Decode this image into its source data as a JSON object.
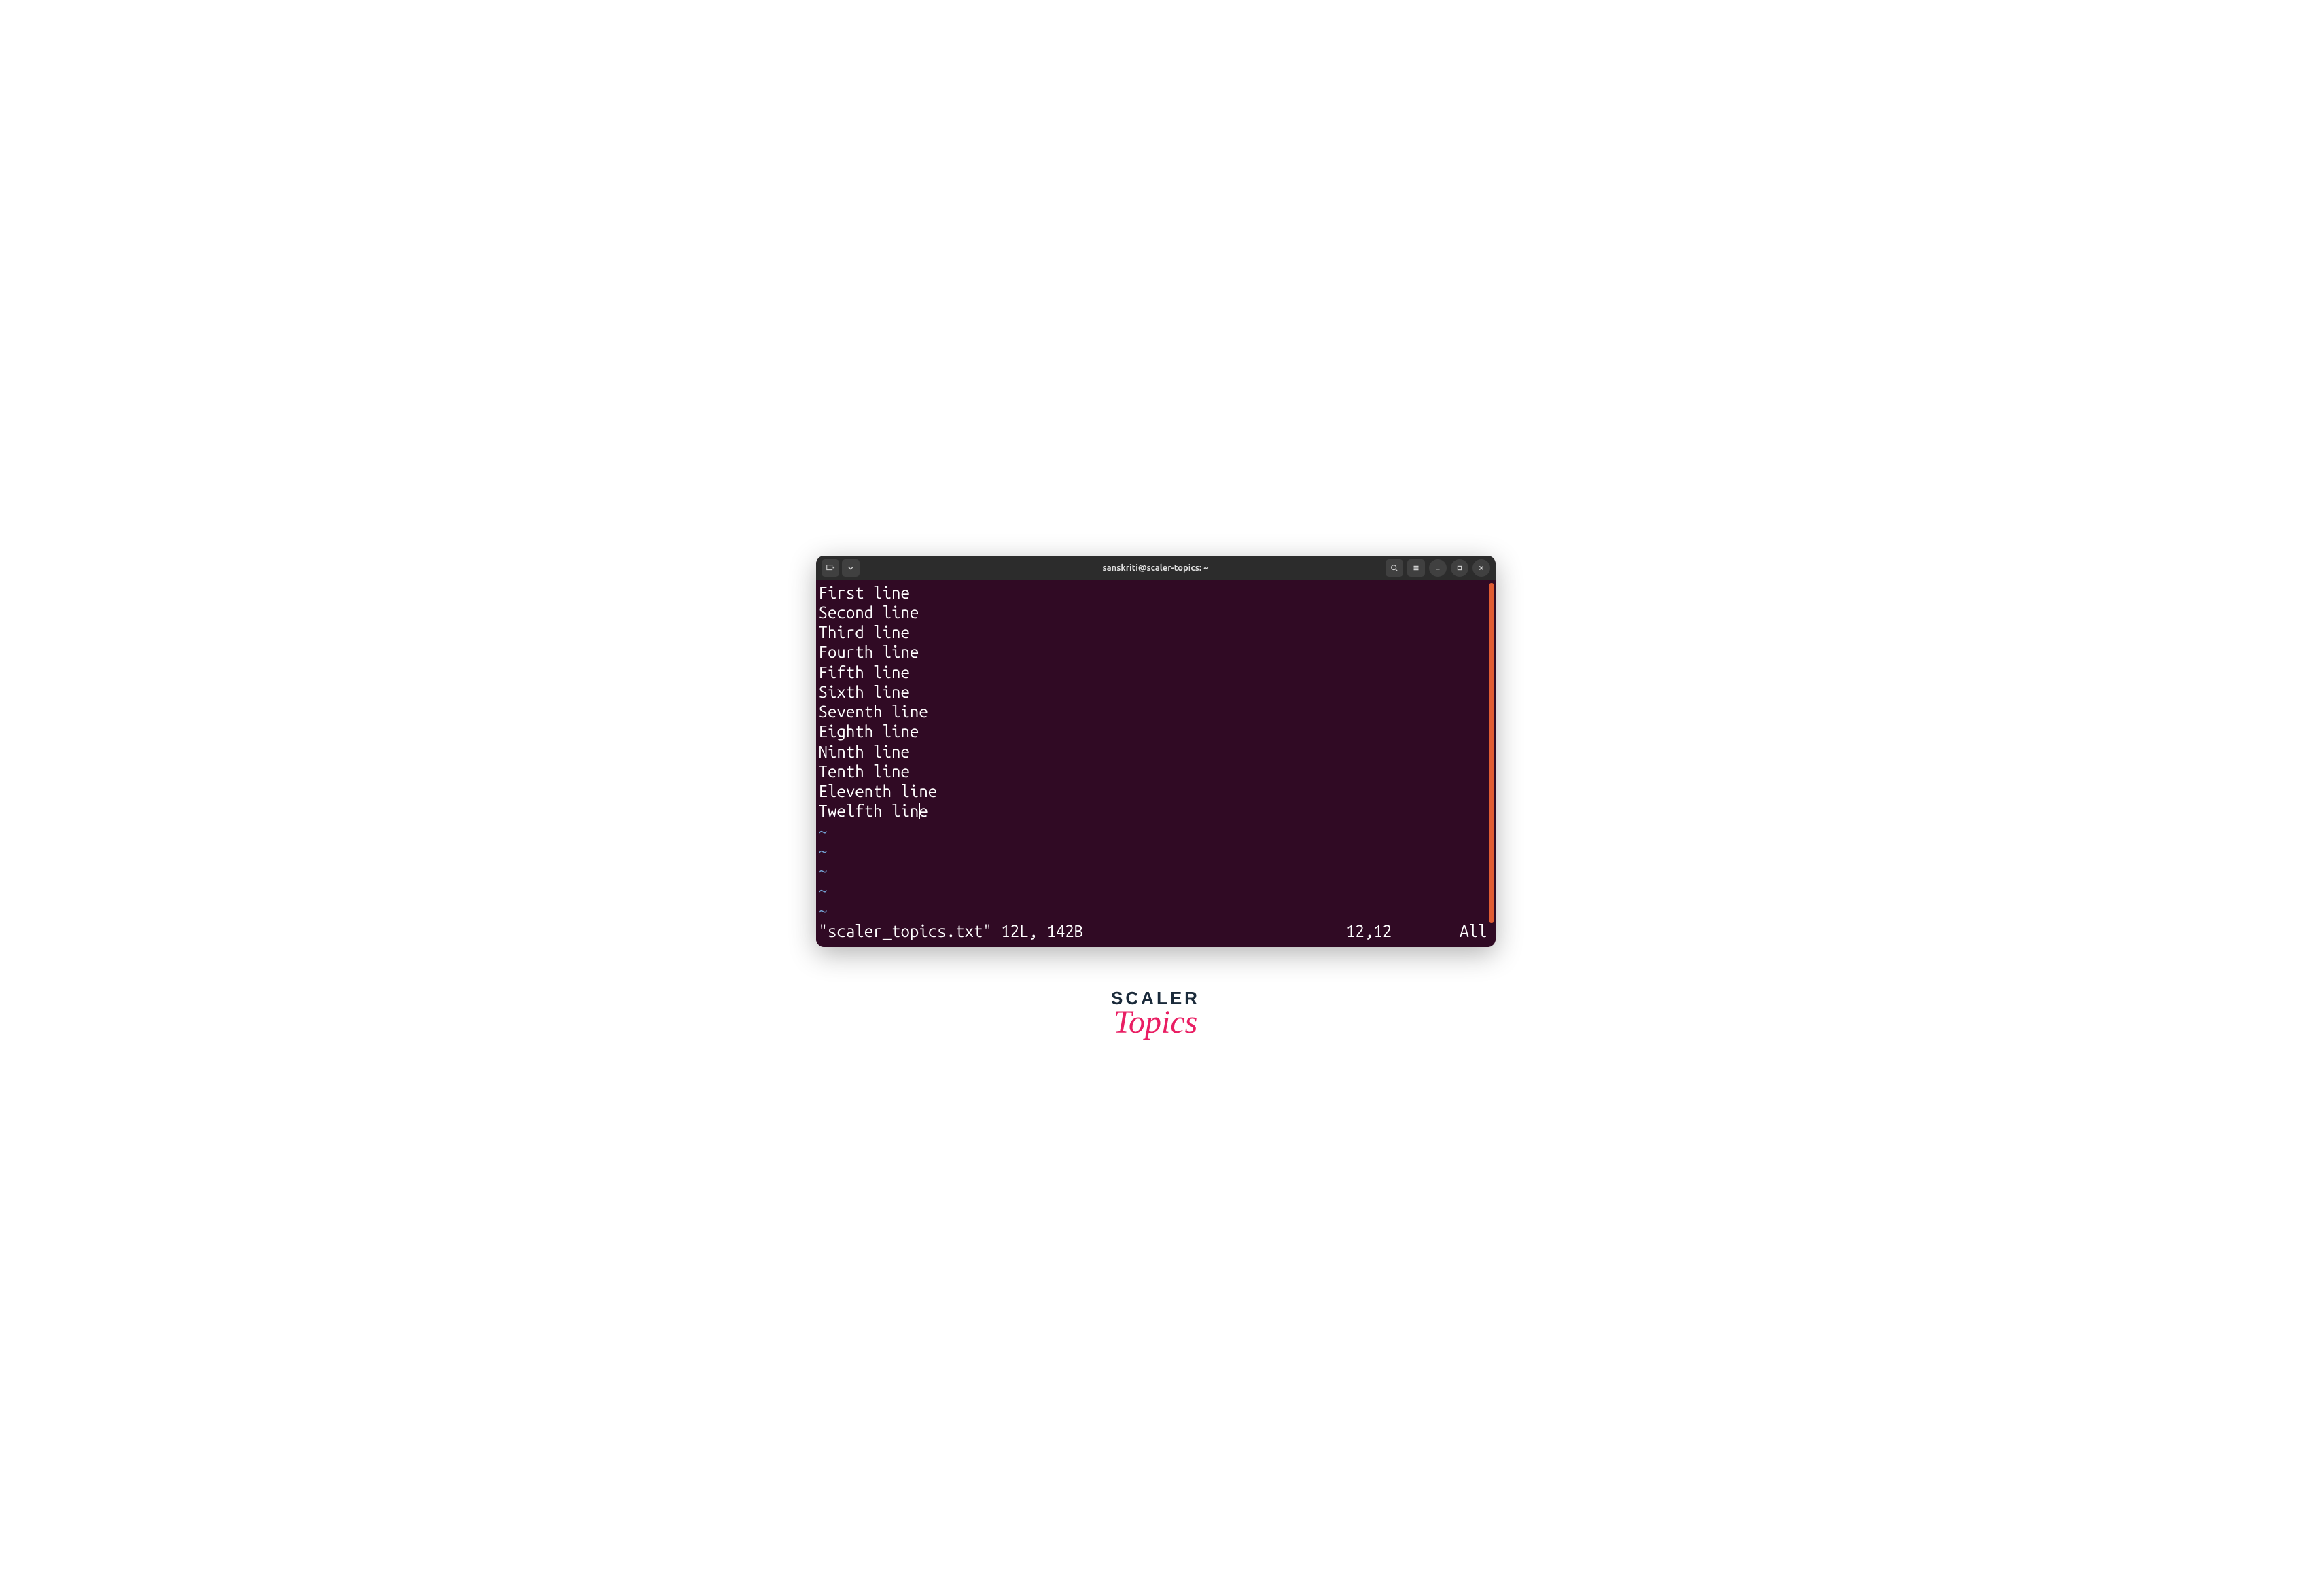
{
  "title_bar": {
    "title": "sanskriti@scaler-topics: ~"
  },
  "editor": {
    "lines": [
      "First line",
      "Second line",
      "Third line",
      "Fourth line",
      "Fifth line",
      "Sixth line",
      "Seventh line",
      "Eighth line",
      "Ninth line",
      "Tenth line",
      "Eleventh line",
      "Twelfth line"
    ],
    "cursor": {
      "line": 11,
      "col": 11
    },
    "empty_tildes": [
      "~",
      "~",
      "~",
      "~",
      "~"
    ]
  },
  "status": {
    "filename": "\"scaler_topics.txt\" 12L, 142B",
    "position": "12,12",
    "scroll": "All"
  },
  "logo": {
    "line1": "SCALER",
    "line2": "Topics"
  }
}
